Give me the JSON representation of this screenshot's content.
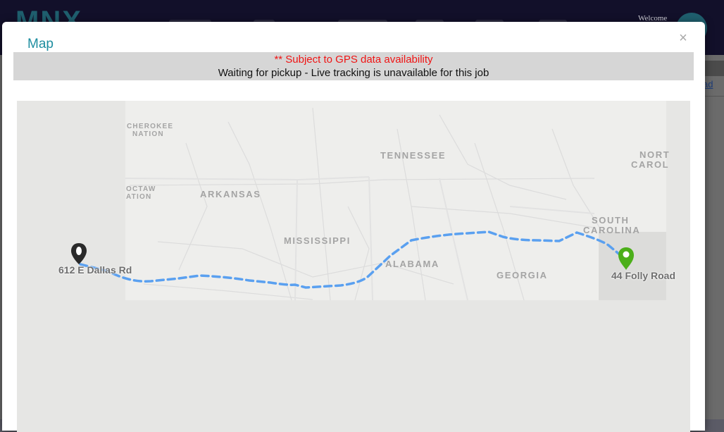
{
  "app": {
    "logo": "MNX",
    "welcome": "Welcome",
    "side_link": "ad"
  },
  "modal": {
    "title": "Map",
    "close_glyph": "×"
  },
  "notice": {
    "warning": "** Subject to GPS data availability",
    "status": "Waiting for pickup - Live tracking is unavailable for this job"
  },
  "map": {
    "regions": {
      "cherokee_1": "CHEROKEE",
      "cherokee_2": "NATION",
      "choctaw_1": "OCTAW",
      "choctaw_2": "ATION",
      "tennessee": "TENNESSEE",
      "north_carolina_1": "NORT",
      "north_carolina_2": "CAROL",
      "arkansas": "ARKANSAS",
      "south_carolina_1": "SOUTH",
      "south_carolina_2": "CAROLINA",
      "mississippi": "MISSISSIPPI",
      "alabama": "ALABAMA",
      "georgia": "GEORGIA"
    },
    "origin": {
      "label": "612 E Dallas Rd",
      "pin_color": "#2a2a2a"
    },
    "destination": {
      "label": "44 Folly Road",
      "pin_color": "#4caf1a"
    },
    "route_color": "#5aa0f0"
  }
}
